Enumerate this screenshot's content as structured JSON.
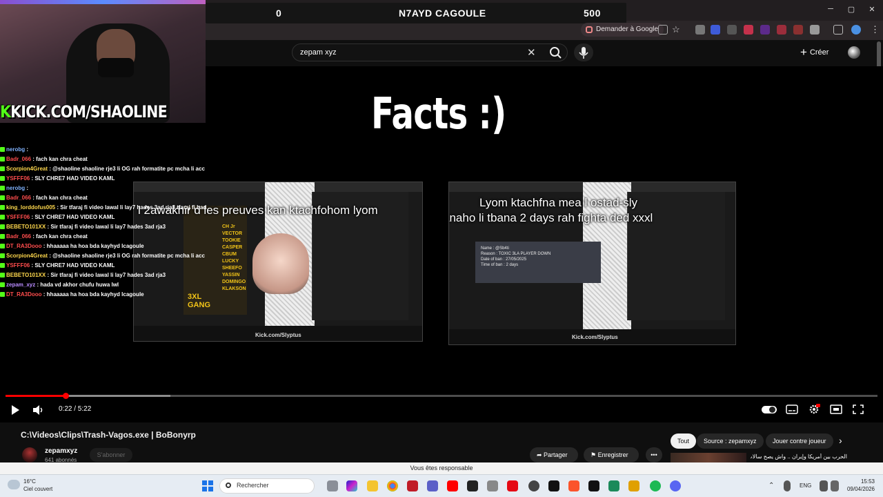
{
  "overlay_bar": {
    "left_score": "0",
    "title": "N7AYD CAGOULE",
    "right_score": "500"
  },
  "browser": {
    "ask_google_label": "Demander à Google",
    "minimize": "─",
    "maximize": "▢",
    "close": "✕"
  },
  "header": {
    "search_value": "zepam xyz",
    "create_label": "Créer",
    "clear_glyph": "✕"
  },
  "stream": {
    "banner_prefix": "K",
    "banner_text": "KICK.COM/SHAOLINE",
    "chat": [
      {
        "user": "nerobg",
        "text": "",
        "color": "#7fb2ff"
      },
      {
        "user": "Badr_066",
        "text": "fach kan chra cheat",
        "color": "#ff4d4d"
      },
      {
        "user": "Scorpion4Great",
        "text": "@shaoline shaoline rje3 li OG rah formatite pc mcha li acc",
        "color": "#ffd84d"
      },
      {
        "user": "YSFFF06",
        "text": "SLY CHRE7 HAD VIDEO KAML",
        "color": "#ff4d4d"
      },
      {
        "user": "nerobg",
        "text": "",
        "color": "#7fb2ff"
      },
      {
        "user": "Badr_066",
        "text": "fach kan chra cheat",
        "color": "#ff4d4d"
      },
      {
        "user": "king_lorddofus005",
        "text": "Sir tfaraj fi video lawal li lay7 hades 3ad rja3 tfaraj fi hada",
        "color": "#ffd84d"
      },
      {
        "user": "YSFFF06",
        "text": "SLY CHRE7 HAD VIDEO KAML",
        "color": "#ff4d4d"
      },
      {
        "user": "BEBETO101XX",
        "text": "Sir tfaraj fi video lawal li lay7 hades 3ad rja3",
        "color": "#ffd84d"
      },
      {
        "user": "Badr_066",
        "text": "fach kan chra cheat",
        "color": "#ff4d4d"
      },
      {
        "user": "DT_RA3Dooo",
        "text": "hhaaaaa ha hoa bda kayhyd lcagoule",
        "color": "#ff4d4d"
      },
      {
        "user": "Scorpion4Great",
        "text": "@shaoline shaoline rje3 li OG rah formatite pc mcha li acc",
        "color": "#ffd84d"
      },
      {
        "user": "YSFFF06",
        "text": "SLY CHRE7 HAD VIDEO KAML",
        "color": "#ff4d4d"
      },
      {
        "user": "BEBETO101XX",
        "text": "Sir tfaraj fi video lawal li lay7 hades 3ad rja3",
        "color": "#ffd84d"
      },
      {
        "user": "zepam_xyz",
        "text": "hada vd akhor chufu huwa lwl",
        "color": "#b98cff"
      },
      {
        "user": "DT_RA3Dooo",
        "text": "hhaaaaa ha hoa bda kayhyd lcagoule",
        "color": "#ff4d4d"
      }
    ]
  },
  "video": {
    "overlay_title": "Facts :)",
    "left_caption": "l 2awakhir d les preuves kan ktachfohom lyom",
    "right_caption_line1": "Lyom ktachfna mea l ostad-sly",
    "right_caption_line2": "anaho li tbana 2 days rah fighta ded xxxl",
    "watermark_left": "Kick.com/Slyptus",
    "watermark_right": "Kick.com/Slyptus",
    "ban_card": {
      "name": "Name : @Sb4ti",
      "reason": "Reason : TOXIC 3LA PLAYER DOWN",
      "date": "Date of ban : 27/05/2025",
      "time": "Time of ban : 2 days"
    },
    "poster_names": [
      "CH Jr",
      "VECTOR",
      "TOOKIE",
      "CASPER",
      "CBUM",
      "LUCKY",
      "SHEEFO",
      "YASSIN",
      "DOMINGO",
      "KLAKSON"
    ],
    "poster_gang": [
      "3XL",
      "GANG"
    ],
    "time": "0:22 / 5:22",
    "progress": {
      "played_fraction": 0.069,
      "buffered_fraction": 0.189
    }
  },
  "below": {
    "title": "C:\\Videos\\Clips\\Trash-Vagos.exe | BoBonyrp",
    "channel_name": "zepamxyz",
    "subscribers": "641 abonnés",
    "subscribe_label": "S'abonner",
    "share_label": "Partager",
    "save_label": "Enregistrer",
    "more_label": "•••",
    "chips": [
      "Tout",
      "Source : zepamxyz",
      "Jouer contre joueur"
    ],
    "chip_next": "›",
    "rec_title": "الحرب بين أمريكا وإيران .. واش يصح سالات"
  },
  "notice": "Vous êtes responsable",
  "taskbar": {
    "temperature": "16°C",
    "weather": "Ciel couvert",
    "search_placeholder": "Rechercher",
    "language": "ENG",
    "time": "15:53",
    "date": "09/04/2026"
  },
  "colors": {
    "accent_red": "#ff0000",
    "kick_green": "#53fc18"
  }
}
